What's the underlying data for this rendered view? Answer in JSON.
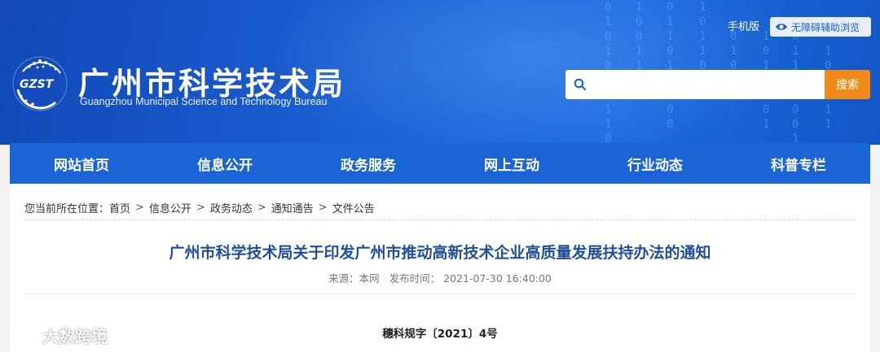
{
  "header": {
    "site_title": "广州市科学技术局",
    "site_subtitle": "Guangzhou Municipal Science and Technology Bureau",
    "logo_text": "GZST",
    "mobile_label": "手机版",
    "accessibility_label": "无障碍辅助浏览",
    "search": {
      "placeholder": "",
      "button_label": "搜索"
    }
  },
  "nav": {
    "items": [
      {
        "label": "网站首页"
      },
      {
        "label": "信息公开"
      },
      {
        "label": "政务服务"
      },
      {
        "label": "网上互动"
      },
      {
        "label": "行业动态"
      },
      {
        "label": "科普专栏"
      }
    ]
  },
  "breadcrumb": {
    "prefix": "您当前所在位置：",
    "items": [
      "首页",
      "信息公开",
      "政务动态",
      "通知通告",
      "文件公告"
    ],
    "separator": ">"
  },
  "article": {
    "title": "广州市科学技术局关于印发广州市推动高新技术企业高质量发展扶持办法的通知",
    "source_label": "来源：本网",
    "published_label": "发布时间：",
    "published_time": "2021-07-30 16:40:00",
    "doc_number": "穗科规字〔2021〕4号"
  },
  "watermark": {
    "text": "大数跨境"
  },
  "colors": {
    "nav_bg": "#1a64d6",
    "search_button": "#ef8a1b",
    "title_blue": "#1f4f9a"
  }
}
